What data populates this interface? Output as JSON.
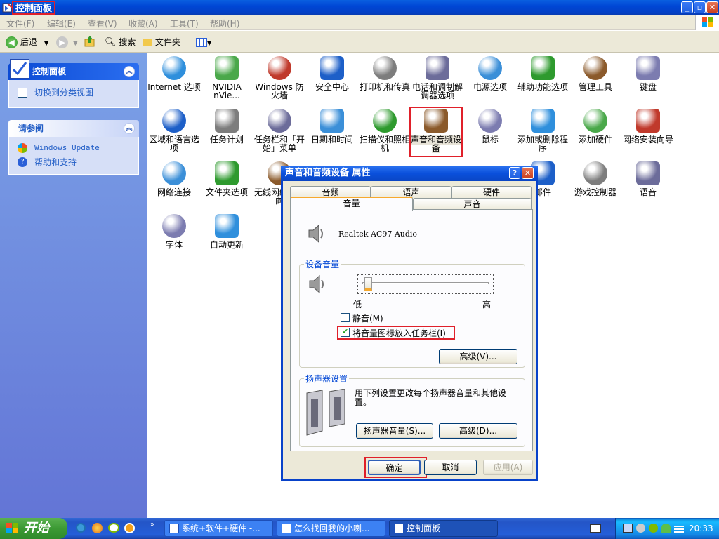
{
  "window": {
    "title": "控制面板"
  },
  "menubar": [
    "文件(F)",
    "编辑(E)",
    "查看(V)",
    "收藏(A)",
    "工具(T)",
    "帮助(H)"
  ],
  "toolbar": {
    "back": "后退",
    "search": "搜索",
    "folders": "文件夹"
  },
  "leftpane": {
    "panel1_title": "控制面板",
    "panel1_link": "切换到分类视图",
    "panel2_title": "请参阅",
    "panel2_links": [
      "Windows Update",
      "帮助和支持"
    ]
  },
  "icons": [
    [
      "Internet 选项",
      "NVIDIA nVie...",
      "Windows 防火墙",
      "安全中心",
      "打印机和传真",
      "电话和调制解调器选项",
      "电源选项",
      "辅助功能选项",
      "管理工具",
      "键盘"
    ],
    [
      "区域和语言选项",
      "任务计划",
      "任务栏和「开始」菜单",
      "日期和时间",
      "扫描仪和照相机",
      "声音和音频设备",
      "鼠标",
      "添加或删除程序",
      "添加硬件",
      "网络安装向导"
    ],
    [
      "网络连接",
      "文件夹选项",
      "无线网络安装向",
      "",
      "",
      "",
      "",
      "邮件",
      "游戏控制器",
      "语音"
    ],
    [
      "字体",
      "自动更新"
    ]
  ],
  "dialog": {
    "title": "声音和音频设备 属性",
    "tabs_back": [
      "音频",
      "语声",
      "硬件"
    ],
    "tabs_front": [
      "音量",
      "声音"
    ],
    "device_name": "Realtek AC97 Audio",
    "device_volume_label": "设备音量",
    "low": "低",
    "high": "高",
    "mute_label": "静音(M)",
    "tray_icon_label": "将音量图标放入任务栏(I)",
    "advanced_btn": "高级(V)...",
    "speaker_group": "扬声器设置",
    "speaker_desc": "用下列设置更改每个扬声器音量和其他设置。",
    "speaker_volume_btn": "扬声器音量(S)...",
    "speaker_advanced_btn": "高级(D)...",
    "ok": "确定",
    "cancel": "取消",
    "apply": "应用(A)",
    "mute_checked": false,
    "tray_checked": true,
    "volume_level": 0.02
  },
  "taskbar": {
    "start": "开始",
    "buttons": [
      "系统+软件+硬件 -...",
      "怎么找回我的小喇...",
      "控制面板"
    ],
    "clock": "20:33"
  },
  "colors": {
    "highlight_red": "#e0202a",
    "xp_blue": "#0046d5",
    "start_green": "#3c9a34"
  }
}
